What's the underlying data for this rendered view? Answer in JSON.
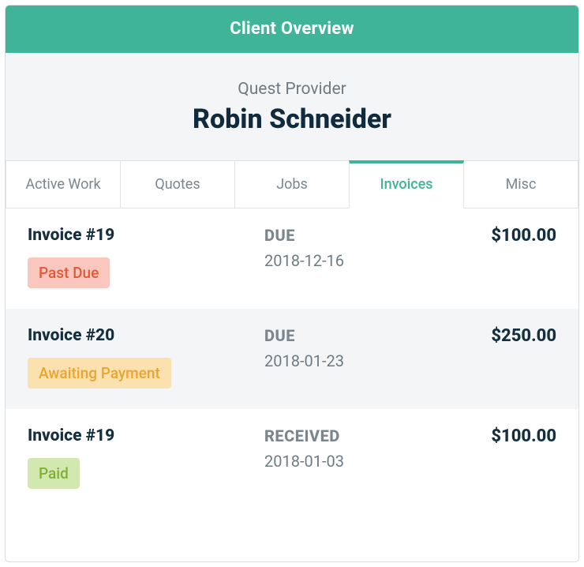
{
  "header": {
    "title": "Client Overview"
  },
  "client": {
    "company": "Quest Provider",
    "name": "Robin Schneider"
  },
  "tabs": [
    {
      "label": "Active Work",
      "active": false
    },
    {
      "label": "Quotes",
      "active": false
    },
    {
      "label": "Jobs",
      "active": false
    },
    {
      "label": "Invoices",
      "active": true
    },
    {
      "label": "Misc",
      "active": false
    }
  ],
  "invoices": [
    {
      "title": "Invoice #19",
      "badge_text": "Past Due",
      "badge_kind": "past-due",
      "status_label": "DUE",
      "date": "2018-12-16",
      "amount": "$100.00",
      "alt": false
    },
    {
      "title": "Invoice #20",
      "badge_text": "Awaiting Payment",
      "badge_kind": "awaiting",
      "status_label": "DUE",
      "date": "2018-01-23",
      "amount": "$250.00",
      "alt": true
    },
    {
      "title": "Invoice #19",
      "badge_text": "Paid",
      "badge_kind": "paid",
      "status_label": "RECEIVED",
      "date": "2018-01-03",
      "amount": "$100.00",
      "alt": false
    }
  ]
}
